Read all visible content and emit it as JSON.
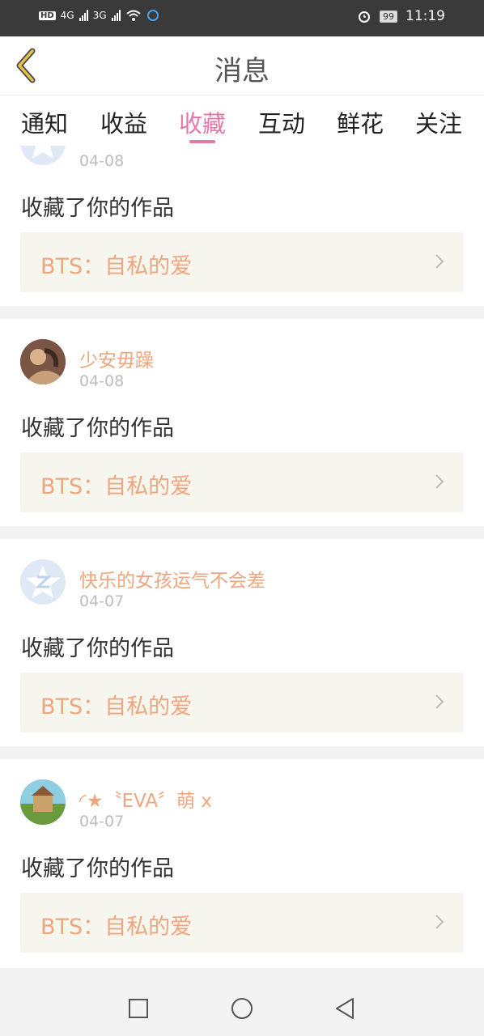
{
  "status_bar": {
    "network_badge": "HD",
    "signal1_label": "4G",
    "signal2_label": "3G",
    "battery": "99",
    "time": "11:19"
  },
  "header": {
    "title": "消息",
    "back_icon": "chevron-left-icon"
  },
  "tabs": [
    {
      "label": "通知"
    },
    {
      "label": "收益"
    },
    {
      "label": "收藏",
      "active": true
    },
    {
      "label": "互动"
    },
    {
      "label": "鲜花"
    },
    {
      "label": "关注"
    }
  ],
  "messages": [
    {
      "user": "",
      "date": "04-08",
      "action": "收藏了你的作品",
      "work": "BTS：自私的爱"
    },
    {
      "user": "少安毋躁",
      "date": "04-08",
      "action": "收藏了你的作品",
      "work": "BTS：自私的爱"
    },
    {
      "user": "快乐的女孩运气不会差",
      "date": "04-07",
      "action": "收藏了你的作品",
      "work": "BTS：自私的爱"
    },
    {
      "user": "◜★〝EVA〞萌 x",
      "date": "04-07",
      "action": "收藏了你的作品",
      "work": "BTS：自私的爱"
    }
  ],
  "colors": {
    "accent_pink": "#e777a8",
    "username_orange": "#eda67e",
    "work_bg": "#f6f5ee",
    "back_arrow": "#e3c14a"
  },
  "nav_bar": {
    "recents_icon": "square-icon",
    "home_icon": "circle-icon",
    "back_icon": "triangle-back-icon"
  }
}
